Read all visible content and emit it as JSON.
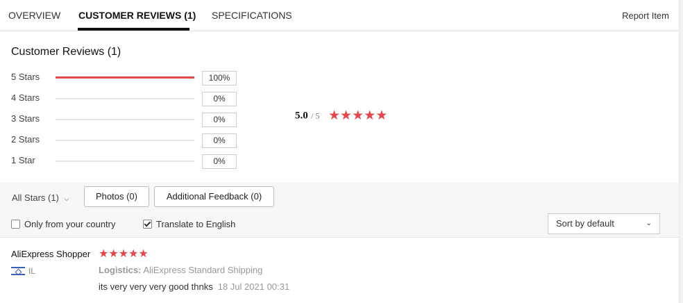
{
  "tabs": [
    {
      "label": "OVERVIEW"
    },
    {
      "label": "CUSTOMER REVIEWS (1)"
    },
    {
      "label": "SPECIFICATIONS"
    }
  ],
  "active_tab": "CUSTOMER REVIEWS (1)",
  "report_item": "Report Item",
  "section_title": "Customer Reviews (1)",
  "distribution": [
    {
      "label": "5 Stars",
      "percent_text": "100%",
      "fraction": 1.0
    },
    {
      "label": "4 Stars",
      "percent_text": "0%",
      "fraction": 0.0
    },
    {
      "label": "3 Stars",
      "percent_text": "0%",
      "fraction": 0.0
    },
    {
      "label": "2 Stars",
      "percent_text": "0%",
      "fraction": 0.0
    },
    {
      "label": "1 Star",
      "percent_text": "0%",
      "fraction": 0.0
    }
  ],
  "average": {
    "value": "5.0",
    "out_of": "/ 5",
    "stars": 5
  },
  "filters": {
    "all_stars": "All Stars (1)",
    "photos": "Photos (0)",
    "additional_feedback": "Additional Feedback (0)",
    "only_country": "Only from your country",
    "only_country_checked": false,
    "translate": "Translate to English",
    "translate_checked": true,
    "sort_value": "Sort by default"
  },
  "review": {
    "reviewer": "AliExpress Shopper",
    "stars": 5,
    "country": "IL",
    "logistics_label": "Logistics:",
    "logistics_value": "AliExpress Standard Shipping",
    "text": "its very very very good thnks",
    "date": "18 Jul 2021 00:31"
  },
  "colors": {
    "accent": "#e2484b",
    "active_underline": "#111111"
  }
}
